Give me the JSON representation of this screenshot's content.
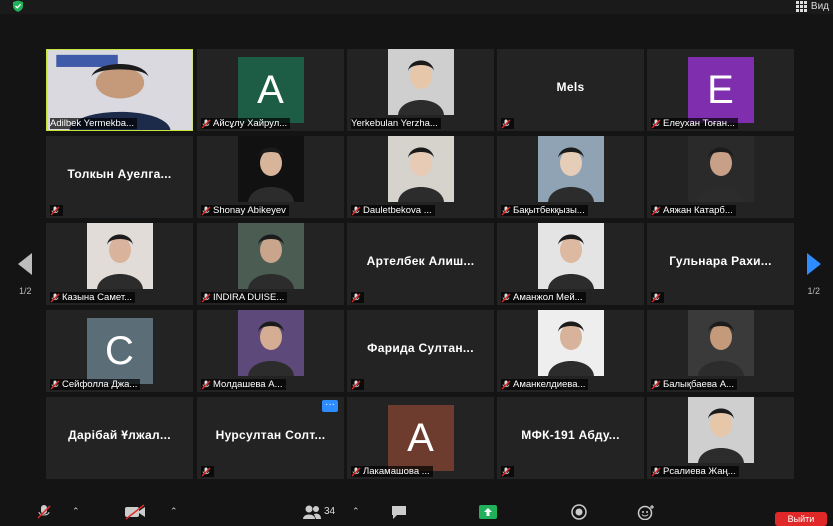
{
  "top": {
    "view_label": "Вид"
  },
  "pager": {
    "left": "1/2",
    "right": "1/2"
  },
  "colors": {
    "active_border": "#c6e53d",
    "accent": "#2d8cff",
    "end": "#e02828"
  },
  "tiles": [
    {
      "label": "Adilbek Yermekba...",
      "kind": "video",
      "active": true
    },
    {
      "label": "Айсұлу Хайрул...",
      "kind": "letter",
      "letter": "A",
      "color": "#1d5c45",
      "muted": true
    },
    {
      "label": "Yerkebulan Yerzha...",
      "kind": "photo",
      "muted": false
    },
    {
      "label": "Mels",
      "kind": "name",
      "muted": true
    },
    {
      "label": "Елеухан Тоған...",
      "kind": "letter",
      "letter": "E",
      "color": "#7f2fae",
      "muted": true
    },
    {
      "label": "Толкын Ауелга...",
      "kind": "name",
      "muted": true
    },
    {
      "label": "Shonay Abikeyev",
      "kind": "photo",
      "muted": true
    },
    {
      "label": "Dauletbekova ...",
      "kind": "photo",
      "muted": true
    },
    {
      "label": "Бақытбекқызы...",
      "kind": "photo",
      "muted": true
    },
    {
      "label": "Аяжан Катарб...",
      "kind": "photo",
      "muted": true
    },
    {
      "label": "Казына Самет...",
      "kind": "photo",
      "muted": true
    },
    {
      "label": "INDIRA DUISE...",
      "kind": "photo",
      "muted": true
    },
    {
      "label": "Артелбек Алиш...",
      "kind": "name",
      "muted": true
    },
    {
      "label": "Аманжол Мей...",
      "kind": "photo",
      "muted": true
    },
    {
      "label": "Гульнара Рахи...",
      "kind": "name",
      "muted": true
    },
    {
      "label": "Сейфолла Джа...",
      "kind": "letter",
      "letter": "C",
      "color": "#5b6e78",
      "muted": true
    },
    {
      "label": "Молдашева А...",
      "kind": "photo",
      "muted": true
    },
    {
      "label": "Фарида Султан...",
      "kind": "name",
      "muted": true
    },
    {
      "label": "Аманкелдиева...",
      "kind": "photo",
      "muted": true
    },
    {
      "label": "Балықбаева А...",
      "kind": "photo",
      "muted": true
    },
    {
      "label": "Дарібай Ұлжал...",
      "kind": "name",
      "muted": false
    },
    {
      "label": "Нурсултан Солт...",
      "kind": "name",
      "muted": true,
      "more": "···"
    },
    {
      "label": "Лакамашова ...",
      "kind": "letter",
      "letter": "A",
      "color": "#6d3c2e",
      "muted": true
    },
    {
      "label": "МФК-191 Абду...",
      "kind": "name",
      "muted": true
    },
    {
      "label": "Рсалиева Жаң...",
      "kind": "photo",
      "muted": true
    }
  ],
  "toolbar": {
    "participants_count": "34",
    "end_label": "Выйти"
  }
}
